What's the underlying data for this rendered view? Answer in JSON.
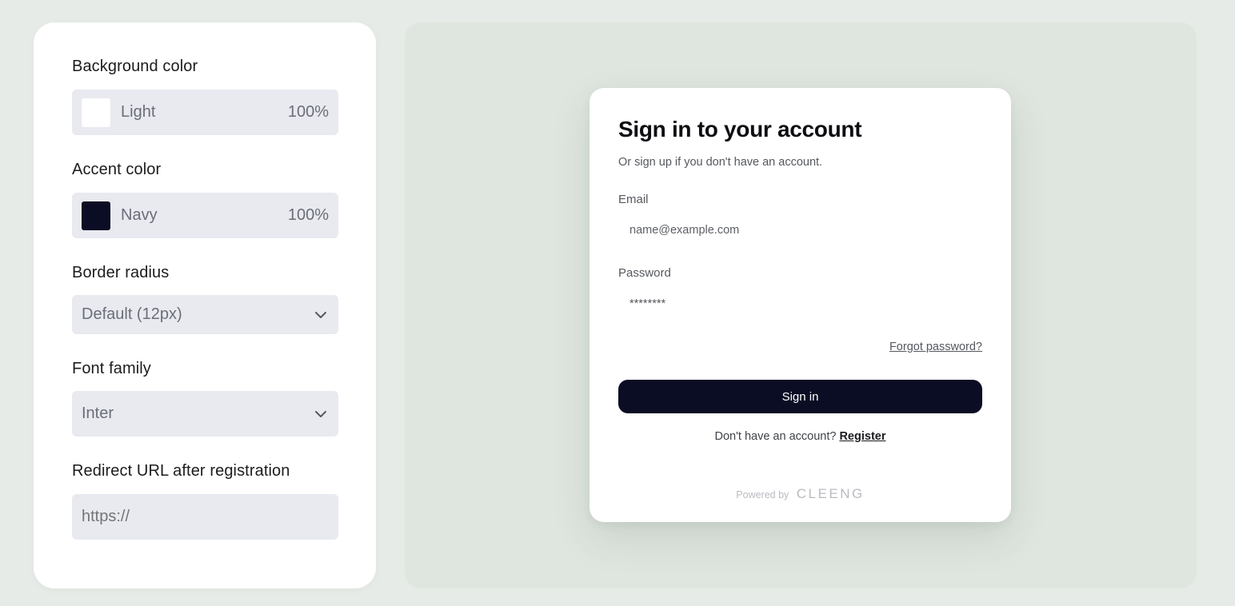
{
  "settings": {
    "background_color": {
      "label": "Background color",
      "value": "Light",
      "percent": "100%",
      "swatch_color": "#ffffff"
    },
    "accent_color": {
      "label": "Accent color",
      "value": "Navy",
      "percent": "100%",
      "swatch_color": "#0b0d24"
    },
    "border_radius": {
      "label": "Border radius",
      "value": "Default (12px)"
    },
    "font_family": {
      "label": "Font family",
      "value": "Inter"
    },
    "redirect_url": {
      "label": "Redirect URL after registration",
      "placeholder": "https://"
    }
  },
  "signin": {
    "title": "Sign in to your account",
    "subtitle": "Or sign up if you don't have an account.",
    "email_label": "Email",
    "email_placeholder": "name@example.com",
    "password_label": "Password",
    "password_value": "********",
    "forgot_password": "Forgot password?",
    "signin_button": "Sign in",
    "no_account_text": "Don't have an account?",
    "register_link": "Register",
    "powered_by": "Powered by",
    "brand": "CLEENG"
  },
  "colors": {
    "page_background": "#e6ebe7",
    "preview_background": "#dfe6df",
    "control_background": "#e8eaf0",
    "accent_navy": "#0b0d24"
  }
}
